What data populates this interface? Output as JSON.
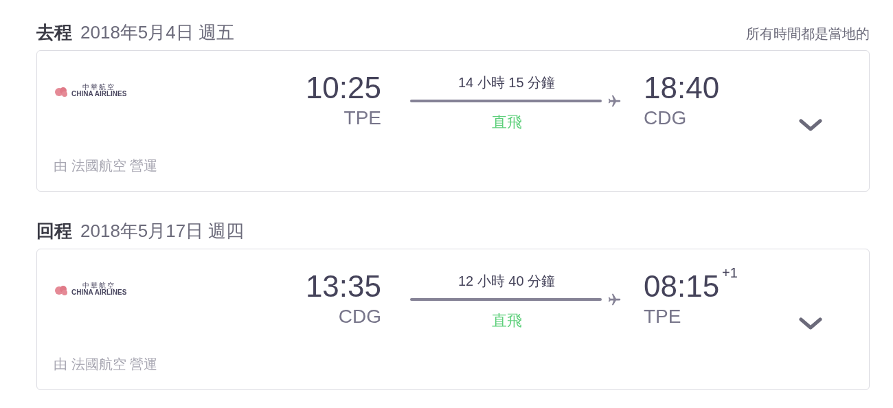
{
  "note": "所有時間都是當地的",
  "legs": [
    {
      "label": "去程",
      "date": "2018年5月4日 週五",
      "logo": {
        "chinese": "中華航空",
        "english": "CHINA AIRLINES"
      },
      "depart": {
        "time": "10:25",
        "airport": "TPE"
      },
      "duration": "14 小時 15 分鐘",
      "stops": "直飛",
      "arrive": {
        "time": "18:40",
        "airport": "CDG"
      },
      "operated_by": "由 法國航空 營運",
      "expanded": false
    },
    {
      "label": "回程",
      "date": "2018年5月17日 週四",
      "logo": {
        "chinese": "中華航空",
        "english": "CHINA AIRLINES"
      },
      "depart": {
        "time": "13:35",
        "airport": "CDG"
      },
      "duration": "12 小時 40 分鐘",
      "stops": "直飛",
      "arrive": {
        "time": "08:15",
        "airport": "TPE",
        "day_offset": "+1"
      },
      "operated_by": "由 法國航空 營運",
      "expanded": false
    }
  ]
}
